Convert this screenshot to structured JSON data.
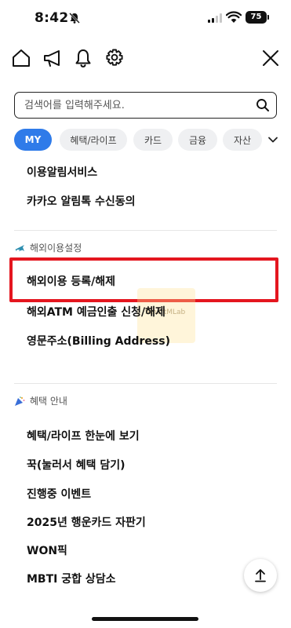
{
  "status_bar": {
    "time": "8:42",
    "battery": "75"
  },
  "search": {
    "placeholder": "검색어를 입력해주세요."
  },
  "chips": [
    {
      "label": "MY",
      "active": true
    },
    {
      "label": "혜택/라이프",
      "active": false
    },
    {
      "label": "카드",
      "active": false
    },
    {
      "label": "금융",
      "active": false
    },
    {
      "label": "자산",
      "active": false
    }
  ],
  "menu_top": {
    "items": [
      "이용알림서비스",
      "카카오 알림톡 수신동의"
    ]
  },
  "overseas": {
    "title": "해외이용설정",
    "items": [
      "해외이용 등록/해제",
      "해외ATM 예금인출 신청/해제",
      "영문주소(Billing Address)"
    ]
  },
  "benefits": {
    "title": "혜택 안내",
    "items": [
      "혜택/라이프 한눈에 보기",
      "꾹(눌러서 혜택 담기)",
      "진행중 이벤트",
      "2025년 행운카드 자판기",
      "WON픽",
      "MBTI 궁합 상담소"
    ]
  },
  "watermark": {
    "text": "SmartMLab"
  },
  "colors": {
    "accent": "#2f7be9",
    "highlight": "#e4161f",
    "chip_bg": "#eff0f2"
  }
}
